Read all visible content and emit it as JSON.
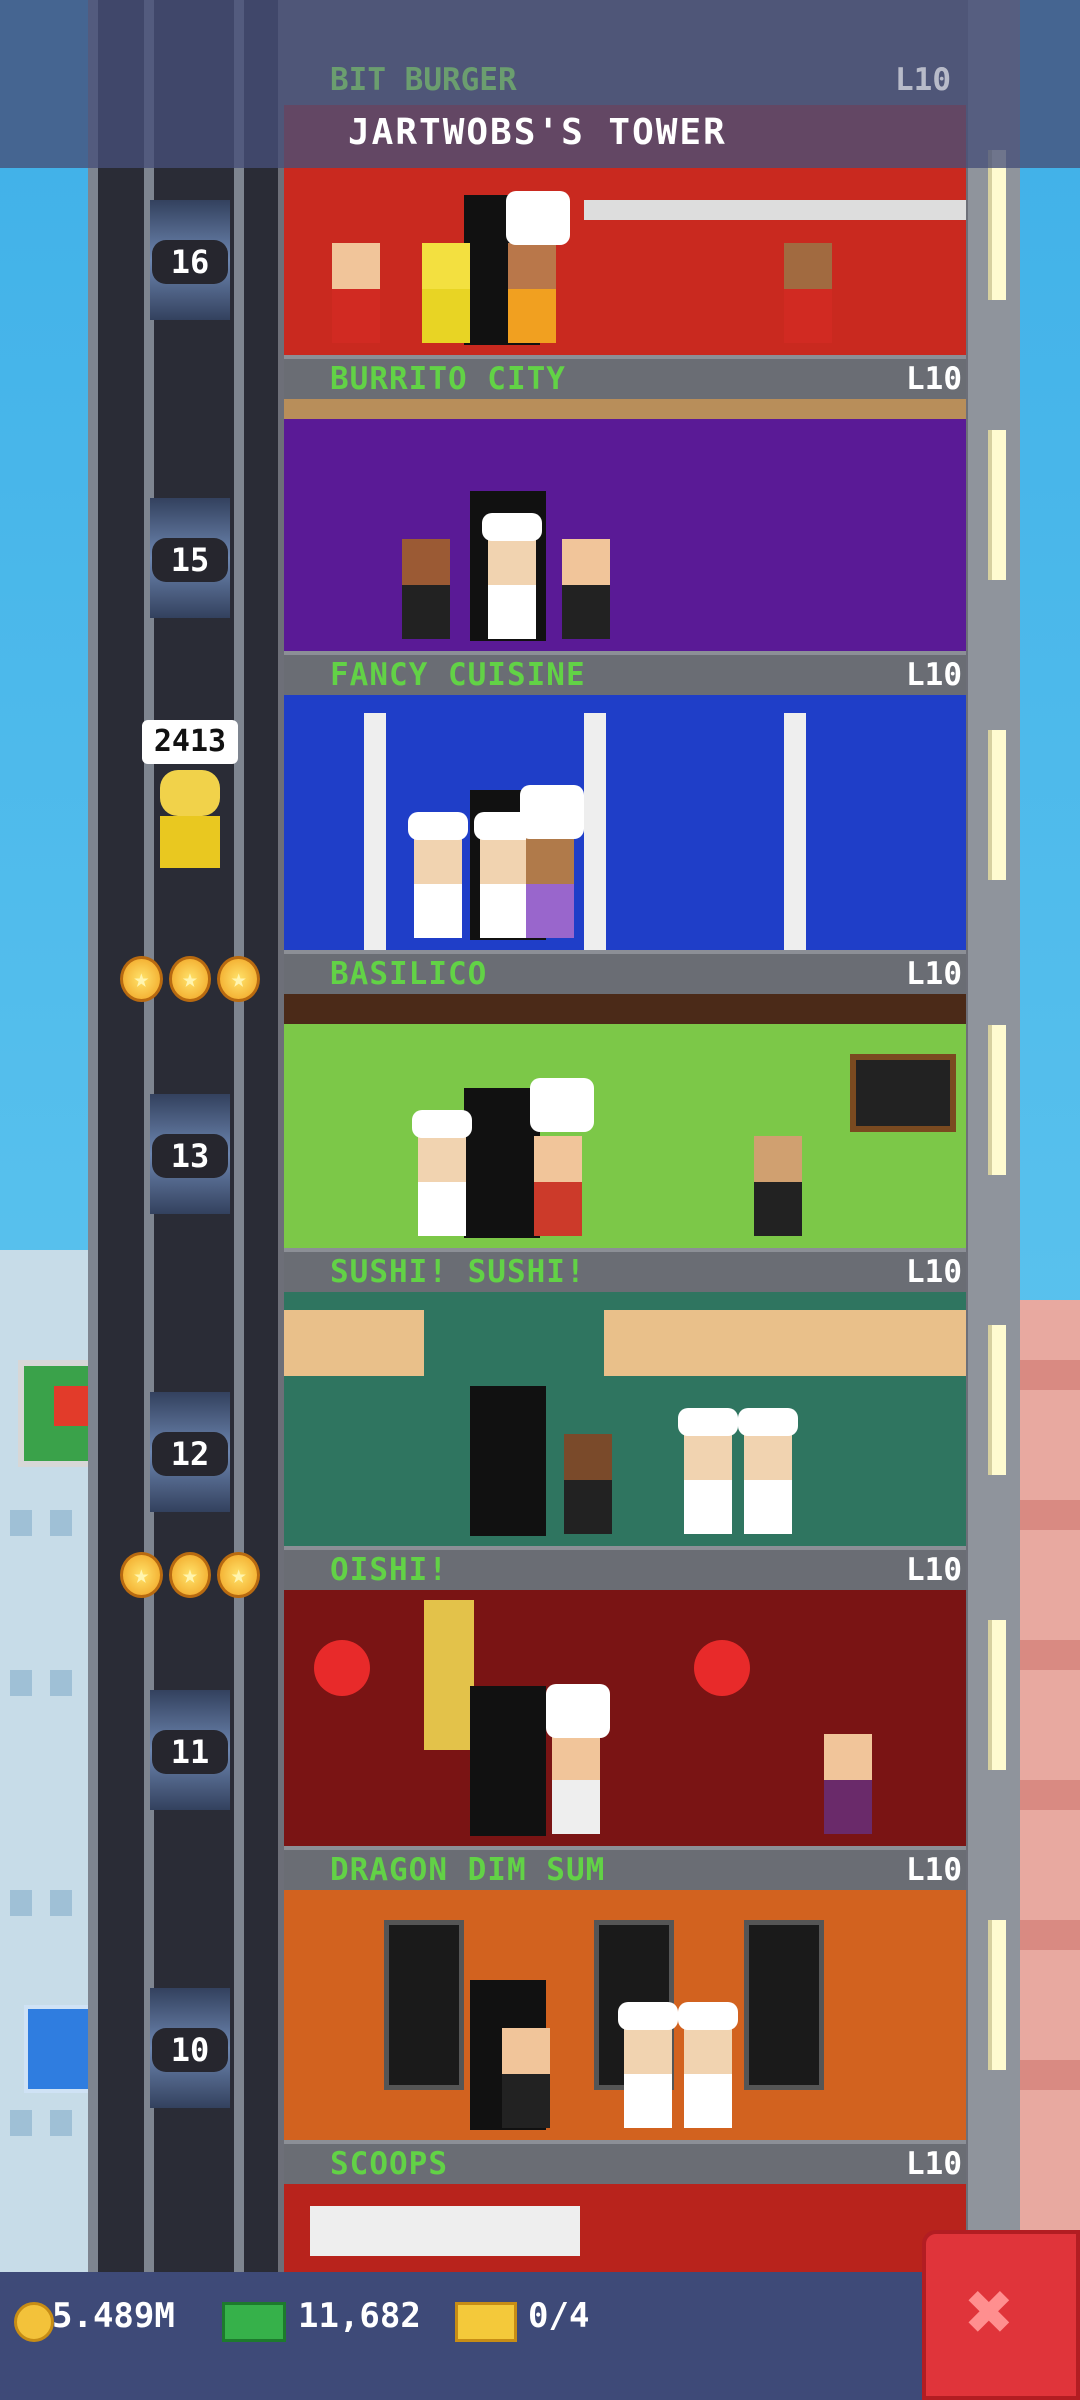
{
  "tower": {
    "title": "JARTWOBS'S TOWER",
    "top_faded_floor_name": "BIT BURGER",
    "top_faded_floor_level": "L10"
  },
  "floors": [
    {
      "number": "16",
      "name": "BURRITO CITY",
      "level": "L10",
      "color": "#c9291f"
    },
    {
      "number": "15",
      "name": "FANCY CUISINE",
      "level": "L10",
      "color": "#5a1a96"
    },
    {
      "number": "",
      "name": "BASILICO",
      "level": "L10",
      "color": "#1f3ec8"
    },
    {
      "number": "13",
      "name": "SUSHI! SUSHI!",
      "level": "L10",
      "color": "#7cc848"
    },
    {
      "number": "12",
      "name": "OISHI!",
      "level": "L10",
      "color": "#2f7560"
    },
    {
      "number": "11",
      "name": "DRAGON DIM SUM",
      "level": "L10",
      "color": "#7a1414"
    },
    {
      "number": "10",
      "name": "SCOOPS",
      "level": "L10",
      "color": "#d2621f"
    }
  ],
  "elevator": {
    "rider_count": "2413",
    "star_rows": 2
  },
  "status": {
    "coins": "5.489M",
    "bux": "11,682",
    "tickets": "0/4"
  },
  "icons": {
    "coins": "coin-icon",
    "bux": "bux-icon",
    "tickets": "ticket-icon",
    "close": "close-icon"
  }
}
